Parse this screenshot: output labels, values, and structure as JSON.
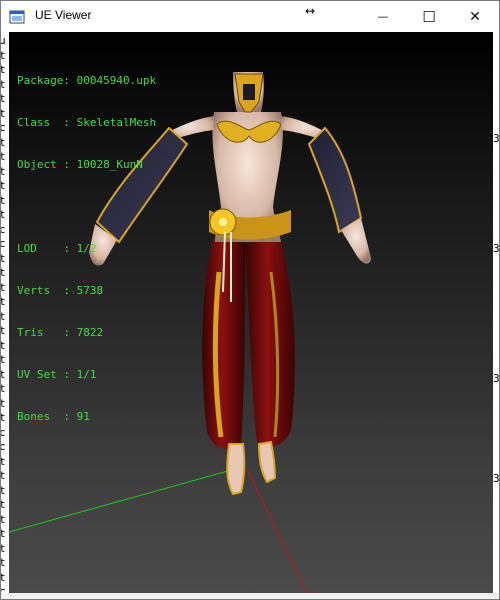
{
  "window": {
    "title": "UE Viewer",
    "resize_glyph": "↔",
    "minimize_glyph": "—",
    "maximize_glyph": "☐",
    "close_glyph": "✕"
  },
  "mesh_info": {
    "package": "Package: 00045940.upk",
    "class": "Class  : SkeletalMesh",
    "object": "Object : 10028_KunN",
    "lod": "LOD    : 1/2",
    "verts": "Verts  : 5738",
    "tris": "Tris   : 7822",
    "uv_set": "UV Set : 1/1",
    "bones": "Bones  : 91"
  },
  "background_console": {
    "left_glyphs": [
      "u",
      "t",
      "t",
      "t",
      "t",
      "t",
      "c",
      "t",
      "t",
      "t",
      "t",
      "t",
      "t",
      "c",
      "c",
      "t",
      "t",
      "t",
      "t",
      "t",
      "t",
      "t",
      "t",
      "t",
      "t",
      "t",
      "t",
      "c",
      "c",
      "t",
      "t",
      "t",
      "t",
      "t",
      "t",
      "t",
      "t",
      "t",
      "c"
    ],
    "right_glyphs": [
      "3",
      "3",
      "3",
      "3",
      "3"
    ]
  },
  "colors": {
    "info_text": "#3be03b",
    "axis_x": "#c81414",
    "axis_y": "#19c819",
    "axis_z": "#2a2acc"
  }
}
